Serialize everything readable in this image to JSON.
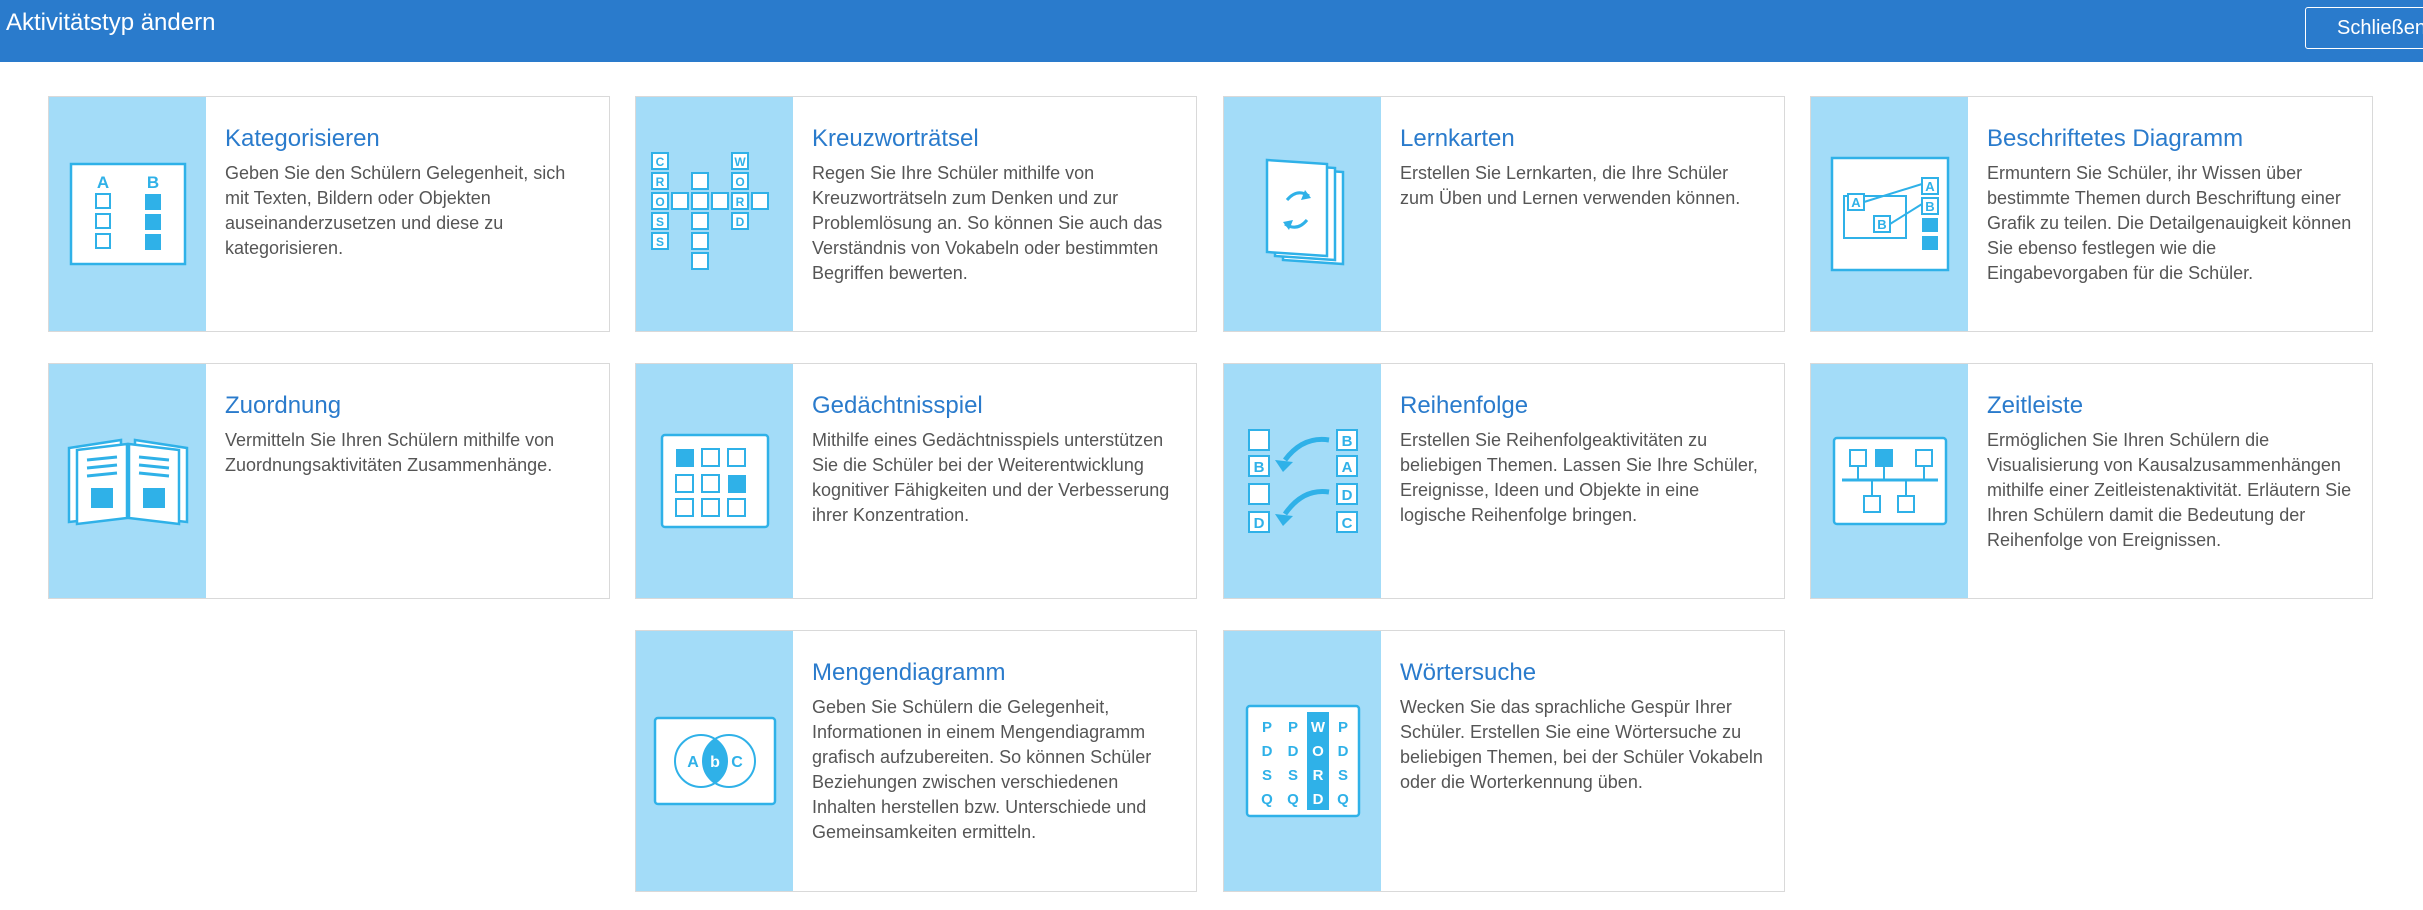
{
  "dialog": {
    "title": "Aktivitätstyp ändern",
    "close_label": "Schließen"
  },
  "activities": [
    {
      "name": "Kategorisieren",
      "icon": "categorize-icon",
      "description": "Geben Sie den Schülern Gelegenheit, sich mit Texten, Bildern oder Objekten auseinanderzusetzen und diese zu kategorisieren."
    },
    {
      "name": "Kreuzworträtsel",
      "icon": "crossword-icon",
      "description": "Regen Sie Ihre Schüler mithilfe von Kreuzworträtseln zum Denken und zur Problemlösung an. So können Sie auch das Verständnis von Vokabeln oder bestimmten Begriffen bewerten."
    },
    {
      "name": "Lernkarten",
      "icon": "flashcards-icon",
      "description": "Erstellen Sie Lernkarten, die Ihre Schüler zum Üben und Lernen verwenden können."
    },
    {
      "name": "Beschriftetes Diagramm",
      "icon": "labeled-diagram-icon",
      "description": "Ermuntern Sie Schüler, ihr Wissen über bestimmte Themen durch Beschriftung einer Grafik zu teilen. Die Detailgenauigkeit können Sie ebenso festlegen wie die Eingabevorgaben für die Schüler."
    },
    {
      "name": "Zuordnung",
      "icon": "matching-icon",
      "description": "Vermitteln Sie Ihren Schülern mithilfe von Zuordnungsaktivitäten Zusammenhänge."
    },
    {
      "name": "Gedächtnisspiel",
      "icon": "memory-game-icon",
      "description": "Mithilfe eines Gedächtnisspiels unterstützen Sie die Schüler bei der Weiterentwicklung kognitiver Fähigkeiten und der Verbesserung ihrer Konzentration."
    },
    {
      "name": "Reihenfolge",
      "icon": "sequence-icon",
      "description": "Erstellen Sie Reihenfolgeaktivitäten zu beliebigen Themen. Lassen Sie Ihre Schüler, Ereignisse, Ideen und Objekte in eine logische Reihenfolge bringen."
    },
    {
      "name": "Zeitleiste",
      "icon": "timeline-icon",
      "description": "Ermöglichen Sie Ihren Schülern die Visualisierung von Kausalzusammenhängen mithilfe einer Zeitleistenaktivität. Erläutern Sie Ihren Schülern damit die Bedeutung der Reihenfolge von Ereignissen."
    },
    {
      "name": "Mengendiagramm",
      "icon": "venn-diagram-icon",
      "description": "Geben Sie Schülern die Gelegenheit, Informationen in einem Mengendiagramm grafisch aufzubereiten. So können Schüler Beziehungen zwischen verschiedenen Inhalten herstellen bzw. Unterschiede und Gemeinsamkeiten ermitteln."
    },
    {
      "name": "Wörtersuche",
      "icon": "word-search-icon",
      "description": "Wecken Sie das sprachliche Gespür Ihrer Schüler. Erstellen Sie eine Wörtersuche zu beliebigen Themen, bei der Schüler Vokabeln oder die Worterkennung üben."
    }
  ],
  "icon_text": {
    "categorize": [
      "A",
      "B"
    ],
    "crossword": [
      "C",
      "R",
      "O",
      "S",
      "S",
      "W",
      "O",
      "R",
      "D"
    ],
    "labeled_diagram": [
      "A",
      "B",
      "A",
      "B"
    ],
    "sequence_left": [
      "B",
      "D"
    ],
    "sequence_right": [
      "B",
      "A",
      "D",
      "C"
    ],
    "venn": [
      "A",
      "b",
      "C"
    ],
    "word_search": [
      [
        "P",
        "P",
        "W",
        "P"
      ],
      [
        "D",
        "D",
        "O",
        "D"
      ],
      [
        "S",
        "S",
        "R",
        "S"
      ],
      [
        "Q",
        "Q",
        "D",
        "Q"
      ]
    ]
  },
  "colors": {
    "header_bg": "#2a7bcc",
    "icon_panel_bg": "#a3dcf8",
    "icon_line": "#2fb1e8",
    "title_link": "#2a7bcc"
  }
}
